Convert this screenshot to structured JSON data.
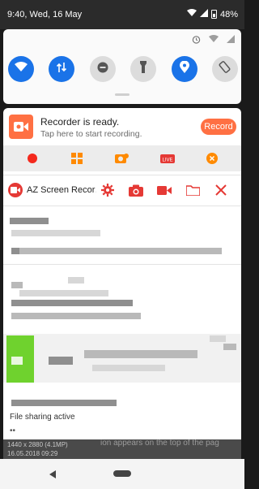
{
  "status_bar": {
    "time": "9:40",
    "date": "Wed, 16 May",
    "battery": "48%"
  },
  "quick_settings": {
    "tiles": [
      {
        "name": "wifi-tile",
        "icon": "wifi-icon",
        "state": "on"
      },
      {
        "name": "mobile-data-tile",
        "icon": "data-arrows-icon",
        "state": "on"
      },
      {
        "name": "do-not-disturb-tile",
        "icon": "dnd-icon",
        "state": "off"
      },
      {
        "name": "flashlight-tile",
        "icon": "flashlight-icon",
        "state": "off"
      },
      {
        "name": "location-tile",
        "icon": "location-pin-icon",
        "state": "on"
      },
      {
        "name": "auto-rotate-tile",
        "icon": "rotate-icon",
        "state": "off"
      }
    ]
  },
  "recorder_notification": {
    "title": "Recorder is ready.",
    "subtitle": "Tap here to start recording.",
    "button": "Record",
    "accent": "#ff7043"
  },
  "recorder_actions": [
    "record-icon",
    "grid-icon",
    "camera-tool-icon",
    "live-icon",
    "close-icon"
  ],
  "az_notification": {
    "label": "AZ Screen Recor…",
    "icons": [
      "settings-icon",
      "camera-icon",
      "video-icon",
      "folder-icon",
      "close-icon"
    ],
    "accent": "#e53935"
  },
  "sharing_text": "File sharing active",
  "background_info": {
    "resolution": "1440 x 2880 (4.1MP)",
    "datetime": "16.05.2018 09:29",
    "partial_text": "ion appears on the top of the pag"
  }
}
